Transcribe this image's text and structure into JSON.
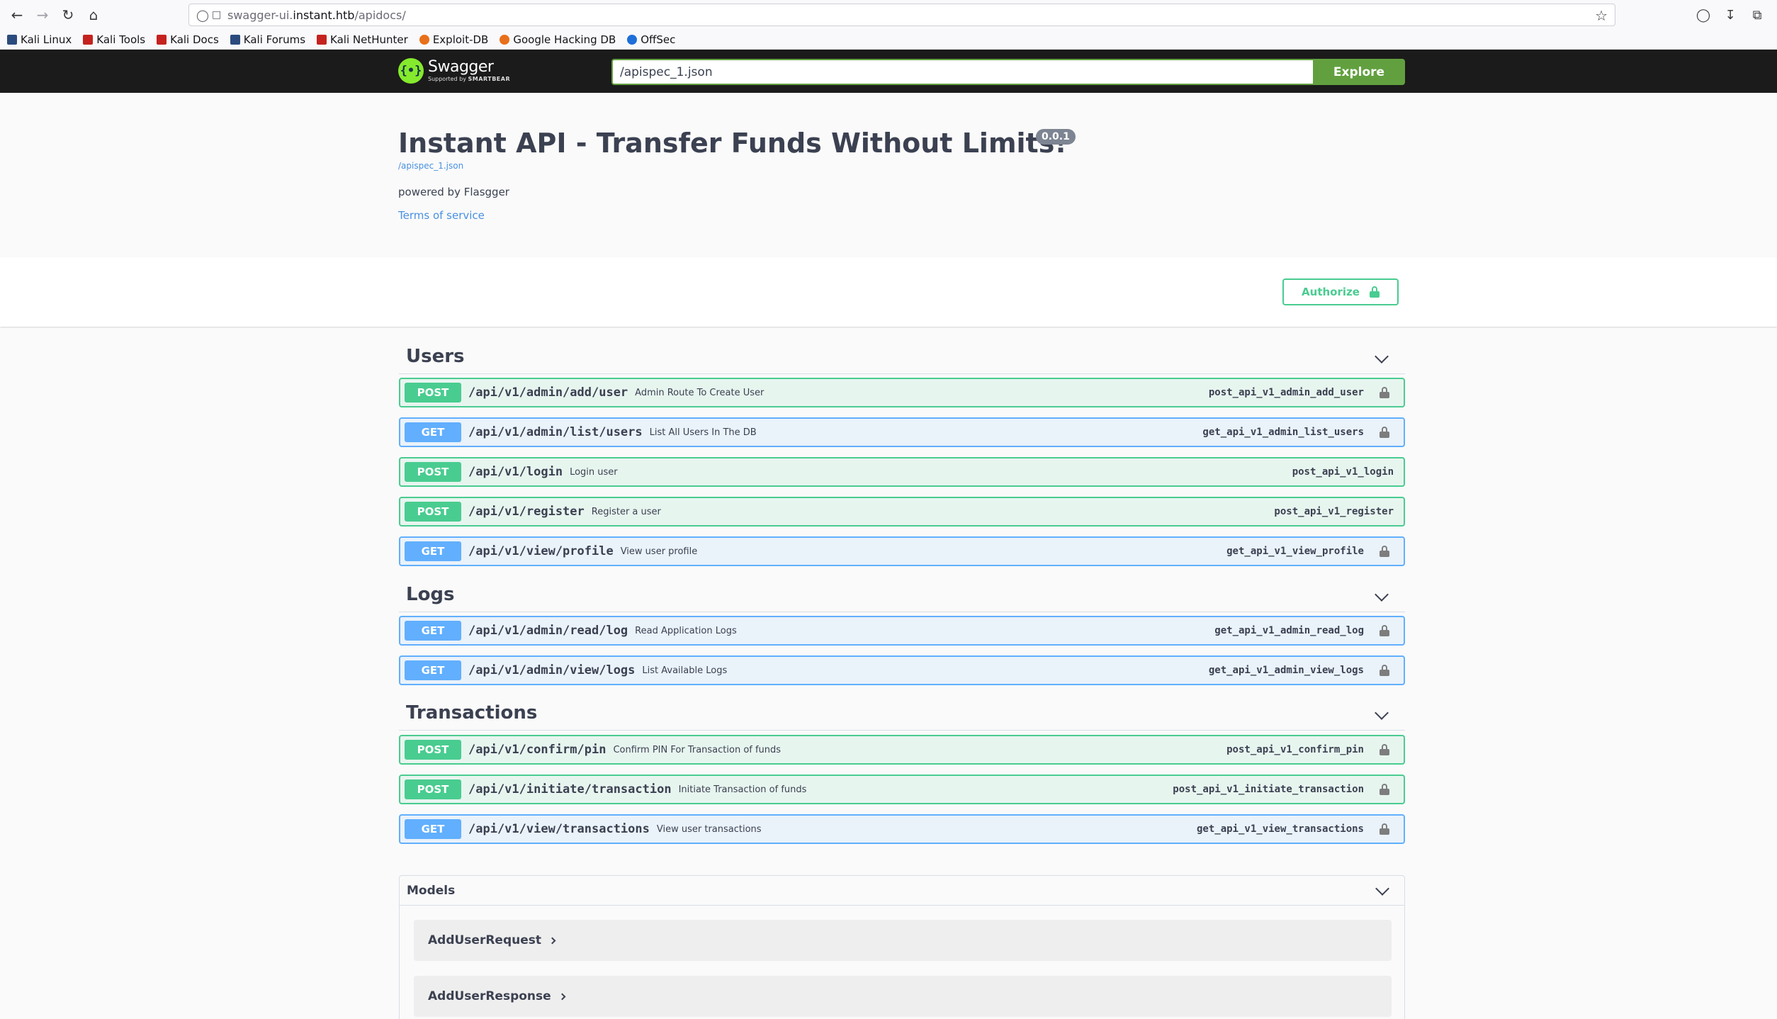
{
  "browser": {
    "url_pre": "swagger-ui.",
    "url_host": "instant.htb",
    "url_post": "/apidocs/",
    "bookmarks": [
      {
        "label": "Kali Linux"
      },
      {
        "label": "Kali Tools"
      },
      {
        "label": "Kali Docs"
      },
      {
        "label": "Kali Forums"
      },
      {
        "label": "Kali NetHunter"
      },
      {
        "label": "Exploit-DB"
      },
      {
        "label": "Google Hacking DB"
      },
      {
        "label": "OffSec"
      }
    ]
  },
  "topbar": {
    "logo_word": "Swagger",
    "logo_sub_pre": "Supported by",
    "logo_sub_brand": "SMARTBEAR",
    "spec_url": "/apispec_1.json",
    "explore_label": "Explore"
  },
  "info": {
    "title": "Instant API - Transfer Funds Without Limits!",
    "version": "0.0.1",
    "spec_link": "/apispec_1.json",
    "powered_by": "powered by Flasgger",
    "terms": "Terms of service"
  },
  "authorize_label": "Authorize",
  "tags": [
    {
      "name": "Users",
      "ops": [
        {
          "method": "POST",
          "path": "/api/v1/admin/add/user",
          "summary": "Admin Route To Create User",
          "operation_id": "post_api_v1_admin_add_user",
          "locked": true
        },
        {
          "method": "GET",
          "path": "/api/v1/admin/list/users",
          "summary": "List All Users In The DB",
          "operation_id": "get_api_v1_admin_list_users",
          "locked": true
        },
        {
          "method": "POST",
          "path": "/api/v1/login",
          "summary": "Login user",
          "operation_id": "post_api_v1_login",
          "locked": false
        },
        {
          "method": "POST",
          "path": "/api/v1/register",
          "summary": "Register a user",
          "operation_id": "post_api_v1_register",
          "locked": false
        },
        {
          "method": "GET",
          "path": "/api/v1/view/profile",
          "summary": "View user profile",
          "operation_id": "get_api_v1_view_profile",
          "locked": true
        }
      ]
    },
    {
      "name": "Logs",
      "ops": [
        {
          "method": "GET",
          "path": "/api/v1/admin/read/log",
          "summary": "Read Application Logs",
          "operation_id": "get_api_v1_admin_read_log",
          "locked": true
        },
        {
          "method": "GET",
          "path": "/api/v1/admin/view/logs",
          "summary": "List Available Logs",
          "operation_id": "get_api_v1_admin_view_logs",
          "locked": true
        }
      ]
    },
    {
      "name": "Transactions",
      "ops": [
        {
          "method": "POST",
          "path": "/api/v1/confirm/pin",
          "summary": "Confirm PIN For Transaction of funds",
          "operation_id": "post_api_v1_confirm_pin",
          "locked": true
        },
        {
          "method": "POST",
          "path": "/api/v1/initiate/transaction",
          "summary": "Initiate Transaction of funds",
          "operation_id": "post_api_v1_initiate_transaction",
          "locked": true
        },
        {
          "method": "GET",
          "path": "/api/v1/view/transactions",
          "summary": "View user transactions",
          "operation_id": "get_api_v1_view_transactions",
          "locked": true
        }
      ]
    }
  ],
  "models": {
    "title": "Models",
    "items": [
      "AddUserRequest",
      "AddUserResponse"
    ]
  },
  "colors": {
    "post": "#49cc90",
    "get": "#61affe",
    "explore": "#62a03f",
    "topbar": "#1b1b1b"
  }
}
